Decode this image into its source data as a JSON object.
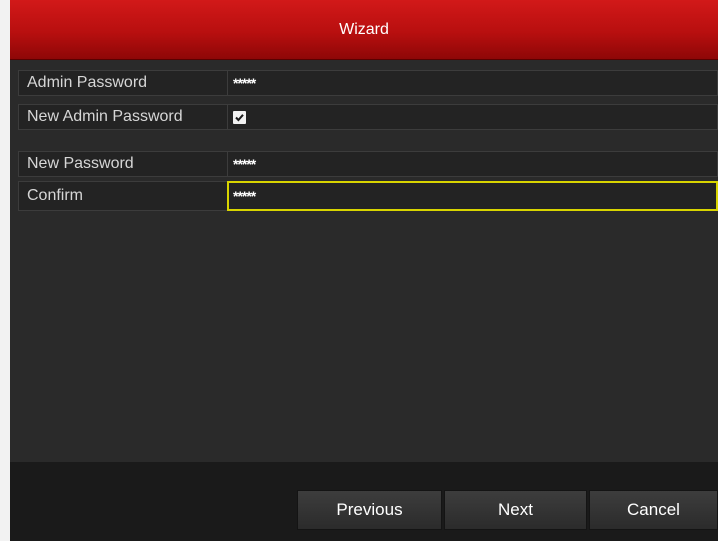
{
  "window": {
    "title": "Wizard"
  },
  "form": {
    "admin_password": {
      "label": "Admin Password",
      "value": "*****"
    },
    "new_admin_password": {
      "label": "New Admin Password",
      "checked": true
    },
    "new_password": {
      "label": "New Password",
      "value": "*****"
    },
    "confirm": {
      "label": "Confirm",
      "value": "*****"
    }
  },
  "buttons": {
    "previous": "Previous",
    "next": "Next",
    "cancel": "Cancel"
  },
  "colors": {
    "titlebar": "#c41212",
    "focus_border": "#d8d400",
    "background": "#2a2a2a"
  }
}
